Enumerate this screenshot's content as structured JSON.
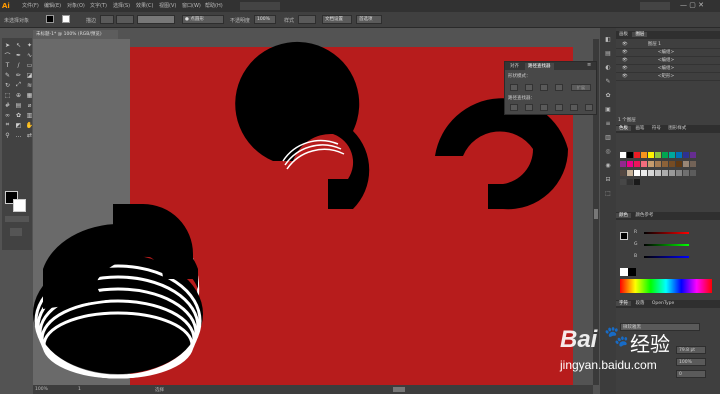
{
  "app": {
    "logo": "Ai"
  },
  "menus": [
    "文件(F)",
    "编辑(E)",
    "对象(O)",
    "文字(T)",
    "选择(S)",
    "效果(C)",
    "视图(V)",
    "窗口(W)",
    "帮助(H)"
  ],
  "control_bar": {
    "selection": "未选择对象",
    "stroke_label": "描边",
    "stroke_value": "",
    "dot_label": "● 点圆形",
    "opacity_label": "不透明度",
    "opacity_value": "100%",
    "style_label": "样式",
    "doc_setup": "文档设置",
    "prefs": "首选项"
  },
  "document_tab": {
    "title": "未标题-1* @ 100% (RGB/预览)"
  },
  "status": {
    "zoom": "100%",
    "page": "1",
    "tool": "选择"
  },
  "pathfinder": {
    "tabs": [
      "对齐",
      "路径查找器"
    ],
    "shape_modes": "形状模式：",
    "expand_label": "扩展",
    "pathfinders": "路径查找器："
  },
  "layers_panel": {
    "tabs": [
      "画板",
      "图层"
    ],
    "rows": [
      "图层 1",
      "<编组>",
      "<编组>",
      "<编组>",
      "<矩形>"
    ],
    "footer": "1 个图层"
  },
  "swatches_panel": {
    "tabs": [
      "色板",
      "画笔",
      "符号",
      "图形样式"
    ],
    "colors": [
      "#ffffff",
      "#000000",
      "#ed1c24",
      "#f7941d",
      "#fff200",
      "#8dc63f",
      "#00a651",
      "#00a99d",
      "#0072bc",
      "#2e3192",
      "#662d91",
      "#92278f",
      "#ec008c",
      "#ed145b",
      "#f26d7d",
      "#c69c6d",
      "#a67c52",
      "#8c6239",
      "#754c24",
      "#603913",
      "#998675",
      "#736357",
      "#534741",
      "#c7b299",
      "#ffffff",
      "#ebebeb",
      "#d7d7d7",
      "#c2c2c2",
      "#adadad",
      "#999999",
      "#858585",
      "#707070",
      "#5c5c5c",
      "#474747",
      "#333333",
      "#1a1a1a"
    ]
  },
  "color_panel": {
    "tabs": [
      "颜色",
      "颜色参考"
    ],
    "channels": [
      {
        "name": "R",
        "color": "#ff4d4d"
      },
      {
        "name": "G",
        "color": "#4dd14d"
      },
      {
        "name": "B",
        "color": "#4d7dff"
      }
    ]
  },
  "char_panel": {
    "tabs": [
      "字符",
      "段落",
      "OpenType"
    ],
    "font_hint": "微软雅黑",
    "size_value": "79.8 pt",
    "leading_value": "100%",
    "tracking_value": "0"
  },
  "watermark": {
    "brand": "Bai",
    "brand2": "经验",
    "url": "jingyan.baidu.com"
  }
}
